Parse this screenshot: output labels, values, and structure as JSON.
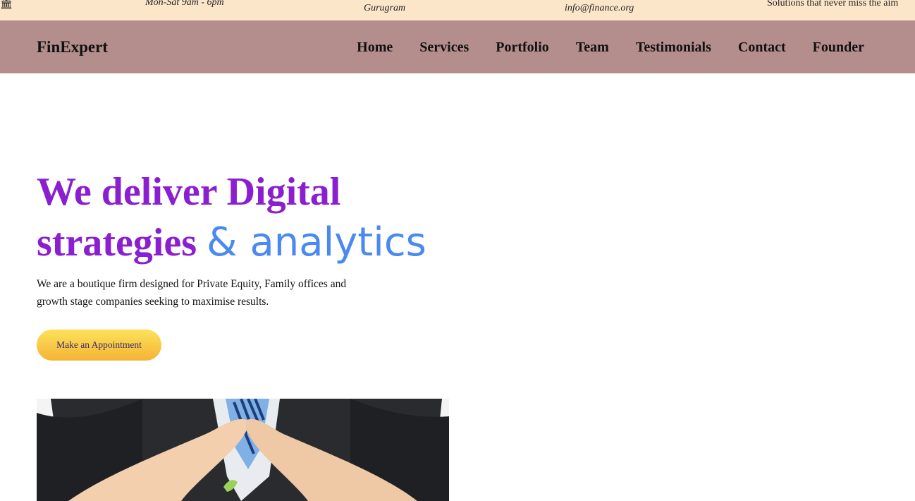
{
  "topbar": {
    "icon": "bank-icon",
    "hours": "Mon-Sat 9am - 6pm",
    "address": "Gurugram",
    "email": "info@finance.org",
    "tagline": "Solutions that never miss the aim"
  },
  "nav": {
    "brand": "FinExpert",
    "links": [
      "Home",
      "Services",
      "Portfolio",
      "Team",
      "Testimonials",
      "Contact",
      "Founder"
    ]
  },
  "hero": {
    "title_main": "We deliver Digital strategies",
    "title_accent": "& analytics",
    "description": "We are a boutique firm designed for Private Equity, Family offices and growth stage companies seeking to maximise results.",
    "cta_label": "Make an Appointment"
  },
  "colors": {
    "topbar_bg": "#fce6c9",
    "navbar_bg": "#b48e8c",
    "title_purple": "#8b1fd0",
    "accent_blue": "#4a8af0",
    "cta_yellow": "#fbd24c"
  }
}
